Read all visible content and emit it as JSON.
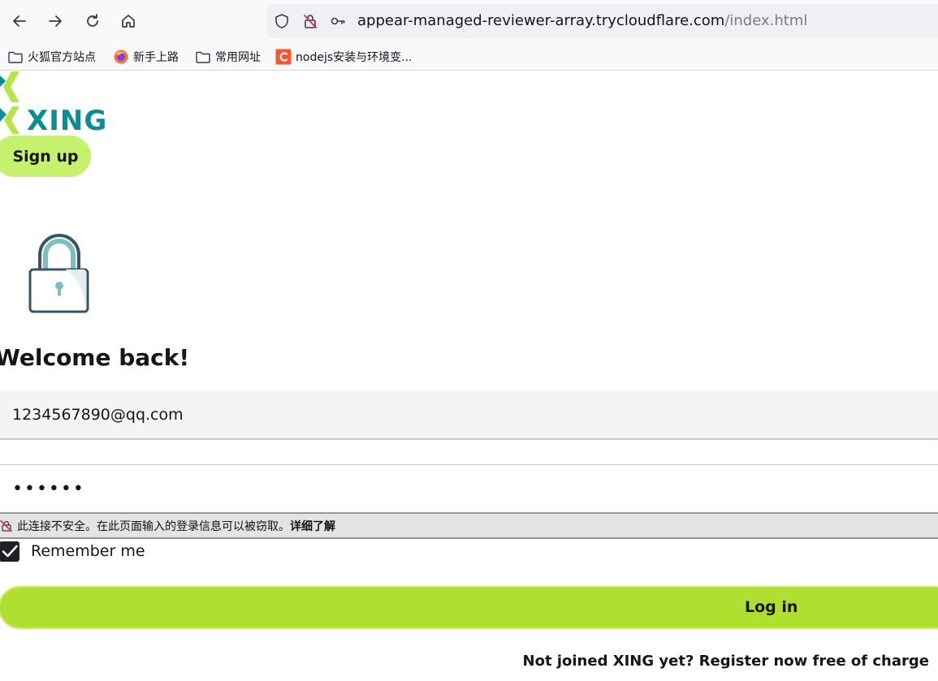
{
  "browser": {
    "url_host": "appear-managed-reviewer-array.trycloudflare.com",
    "url_path": "/index.html",
    "icons": [
      "back-arrow-icon",
      "forward-arrow-icon",
      "reload-icon",
      "home-icon",
      "shield-icon",
      "insecure-lock-icon",
      "key-icon"
    ]
  },
  "bookmarks": [
    {
      "label": "火狐官方站点",
      "icon": "folder-icon"
    },
    {
      "label": "新手上路",
      "icon": "firefox-icon"
    },
    {
      "label": "常用网址",
      "icon": "folder-icon"
    },
    {
      "label": "nodejs安装与环境变...",
      "icon": "csdn-icon"
    }
  ],
  "page": {
    "logo_text": "XING",
    "signup_label": "Sign up",
    "welcome_heading": "Welcome back!",
    "email_value": "1234567890@qq.com",
    "password_value": "••••••",
    "insecure_warning": "此连接不安全。在此页面输入的登录信息可以被窃取。",
    "learn_more": "详细了解",
    "remember_label": "Remember me",
    "remember_checked": true,
    "login_label": "Log in",
    "register_text": "Not joined XING yet? Register now free of charge"
  },
  "colors": {
    "brand_teal": "#0a8e92",
    "brand_lime": "#afe02f",
    "signup_lime": "#c6f16d",
    "logo_chevron": "#b8e44a"
  }
}
